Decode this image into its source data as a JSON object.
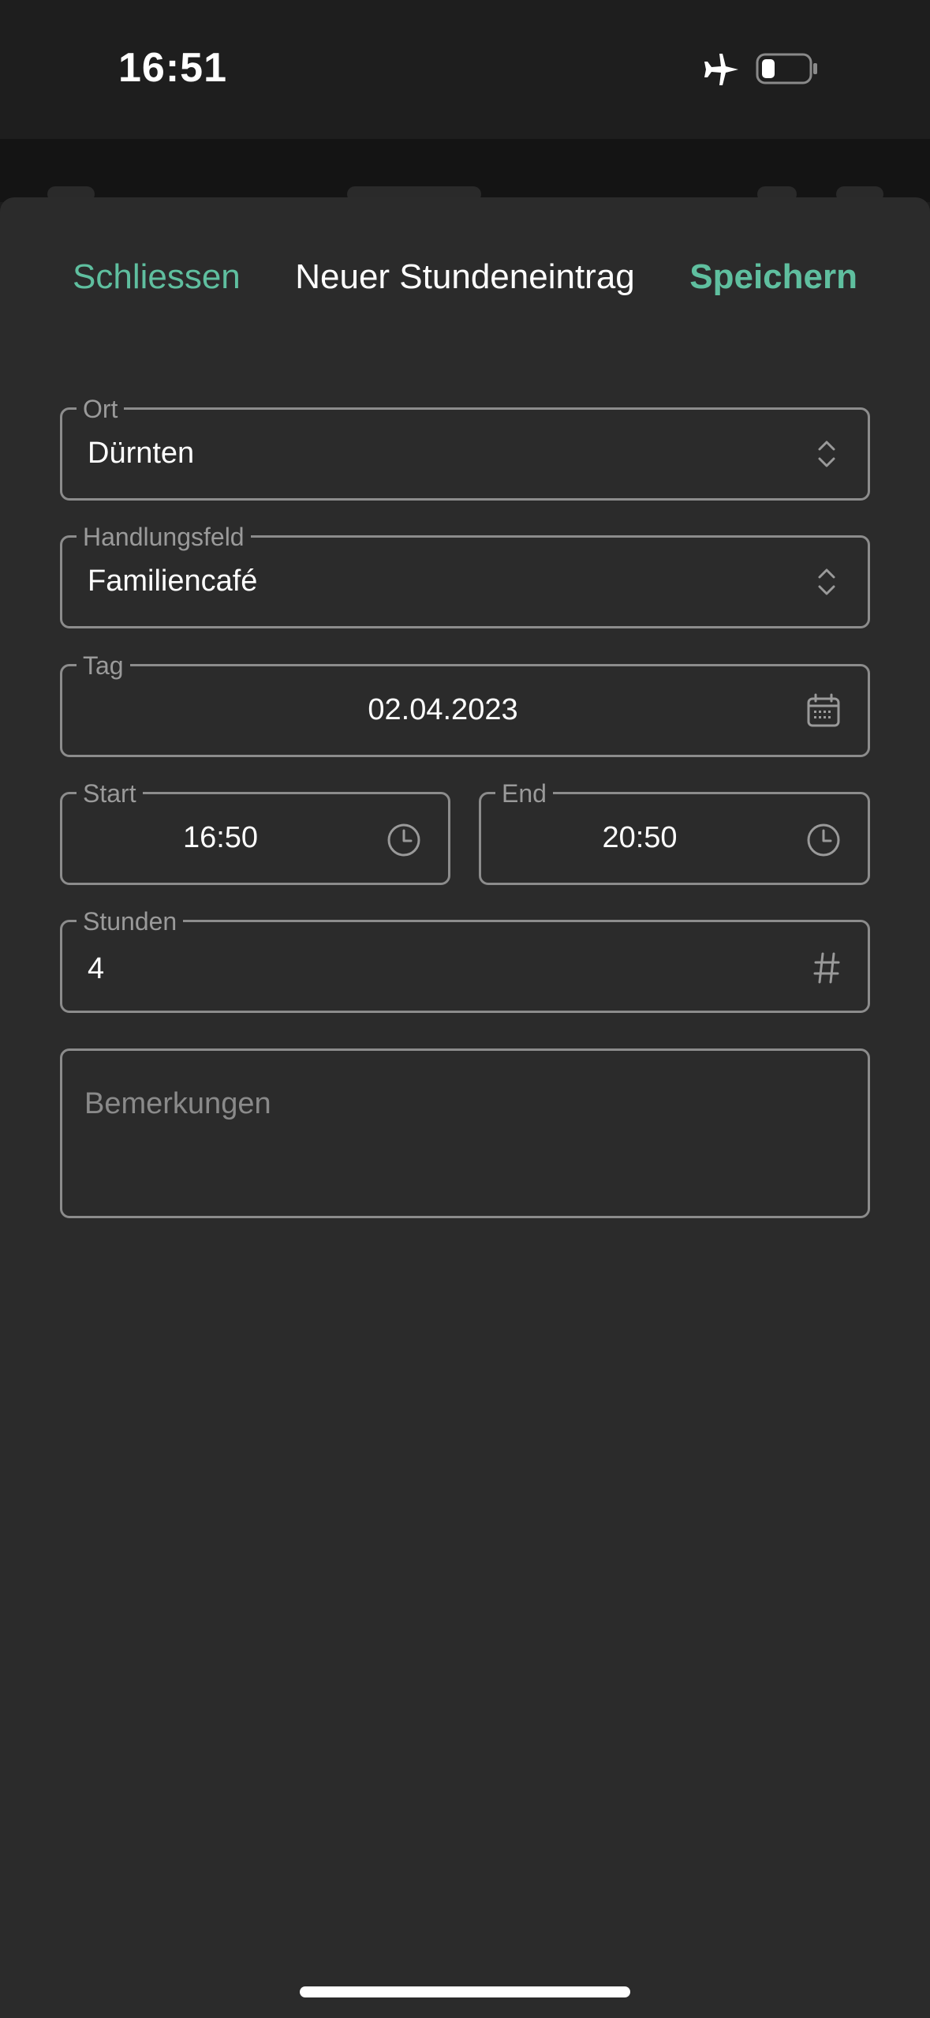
{
  "status_bar": {
    "time": "16:51"
  },
  "header": {
    "close_label": "Schliessen",
    "title": "Neuer Stundeneintrag",
    "save_label": "Speichern"
  },
  "form": {
    "ort": {
      "label": "Ort",
      "value": "Dürnten"
    },
    "handlungsfeld": {
      "label": "Handlungsfeld",
      "value": "Familiencafé"
    },
    "tag": {
      "label": "Tag",
      "value": "02.04.2023"
    },
    "start": {
      "label": "Start",
      "value": "16:50"
    },
    "end": {
      "label": "End",
      "value": "20:50"
    },
    "stunden": {
      "label": "Stunden",
      "value": "4"
    },
    "bemerkungen": {
      "placeholder": "Bemerkungen"
    }
  },
  "colors": {
    "accent": "#5fbf9f",
    "sheet_background": "#2b2b2b",
    "field_border": "#8c8c8c"
  },
  "icons": {
    "select": "chevron-up-down-icon",
    "date": "calendar-icon",
    "time": "clock-icon",
    "number": "hash-icon"
  }
}
